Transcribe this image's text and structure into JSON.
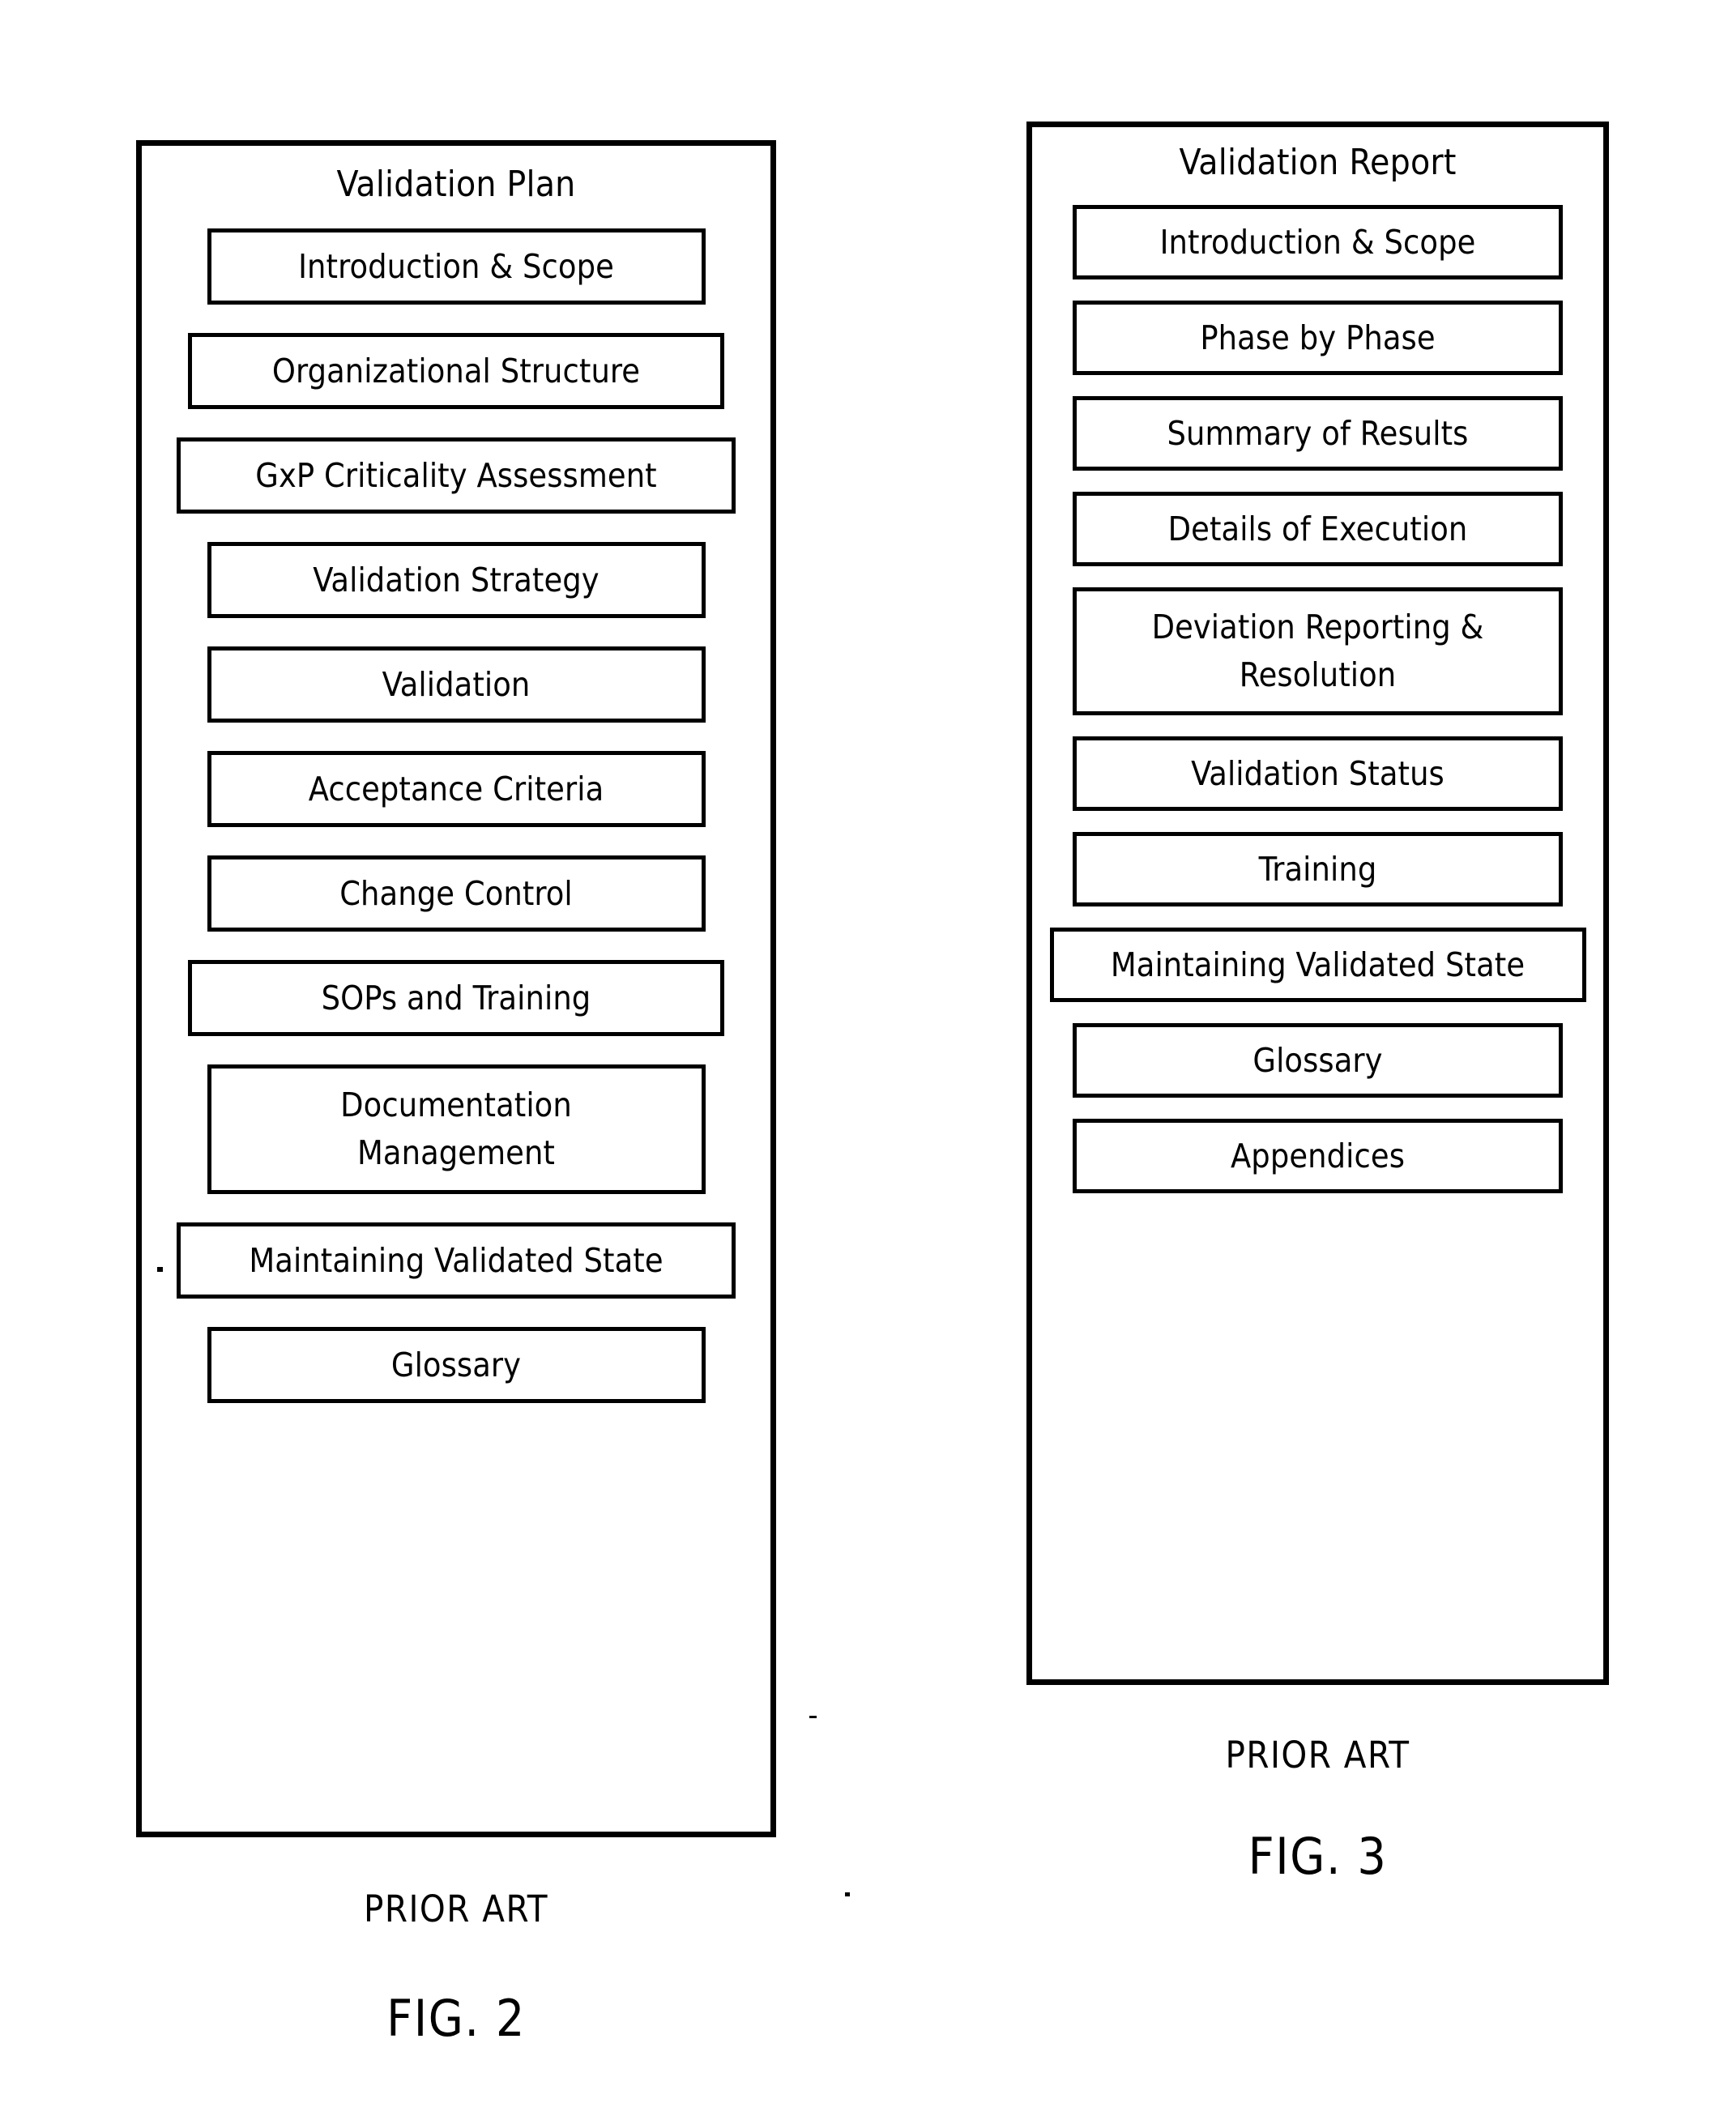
{
  "figures": [
    {
      "id": "fig-2",
      "panel_title": "Validation Plan",
      "items": [
        {
          "label": "Introduction & Scope",
          "size": "normal",
          "lines": [
            "Introduction & Scope"
          ]
        },
        {
          "label": "Organizational Structure",
          "size": "wide",
          "lines": [
            "Organizational Structure"
          ]
        },
        {
          "label": "GxP Criticality Assessment",
          "size": "widest",
          "lines": [
            "GxP Criticality Assessment"
          ]
        },
        {
          "label": "Validation Strategy",
          "size": "normal",
          "lines": [
            "Validation Strategy"
          ]
        },
        {
          "label": "Validation",
          "size": "normal",
          "lines": [
            "Validation"
          ]
        },
        {
          "label": "Acceptance Criteria",
          "size": "normal",
          "lines": [
            "Acceptance Criteria"
          ]
        },
        {
          "label": "Change Control",
          "size": "normal",
          "lines": [
            "Change Control"
          ]
        },
        {
          "label": "SOPs and Training",
          "size": "wide",
          "lines": [
            "SOPs and Training"
          ]
        },
        {
          "label": "Documentation Management",
          "size": "normal",
          "lines": [
            "Documentation",
            "Management"
          ]
        },
        {
          "label": "Maintaining Validated State",
          "size": "widest",
          "lines": [
            "Maintaining Validated State"
          ]
        },
        {
          "label": "Glossary",
          "size": "normal",
          "lines": [
            "Glossary"
          ]
        }
      ],
      "caption": {
        "prior_art": "PRIOR ART",
        "fig_no": "FIG. 2"
      }
    },
    {
      "id": "fig-3",
      "panel_title": "Validation Report",
      "items": [
        {
          "label": "Introduction & Scope",
          "size": "normal",
          "lines": [
            "Introduction & Scope"
          ]
        },
        {
          "label": "Phase by Phase",
          "size": "normal",
          "lines": [
            "Phase by Phase"
          ]
        },
        {
          "label": "Summary of Results",
          "size": "normal",
          "lines": [
            "Summary of Results"
          ]
        },
        {
          "label": "Details of Execution",
          "size": "normal",
          "lines": [
            "Details of Execution"
          ]
        },
        {
          "label": "Deviation Reporting & Resolution",
          "size": "normal",
          "lines": [
            "Deviation Reporting &",
            "Resolution"
          ]
        },
        {
          "label": "Validation Status",
          "size": "normal",
          "lines": [
            "Validation Status"
          ]
        },
        {
          "label": "Training",
          "size": "normal",
          "lines": [
            "Training"
          ]
        },
        {
          "label": "Maintaining Validated State",
          "size": "widest",
          "lines": [
            "Maintaining Validated State"
          ]
        },
        {
          "label": "Glossary",
          "size": "normal",
          "lines": [
            "Glossary"
          ]
        },
        {
          "label": "Appendices",
          "size": "normal",
          "lines": [
            "Appendices"
          ]
        }
      ],
      "caption": {
        "prior_art": "PRIOR ART",
        "fig_no": "FIG. 3"
      }
    }
  ],
  "colors": {
    "ink": "#000000",
    "paper": "#ffffff"
  }
}
